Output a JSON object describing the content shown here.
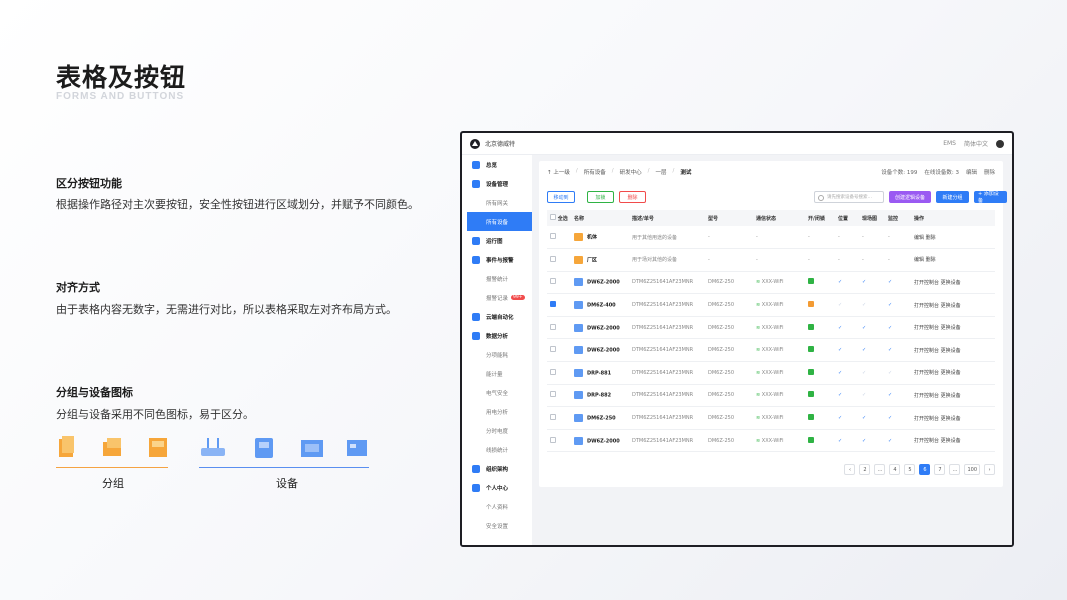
{
  "slide": {
    "title": "表格及按钮",
    "subtitle": "FORMS AND BUTTONS",
    "sections": [
      {
        "heading": "区分按钮功能",
        "text": "根据操作路径对主次要按钮，安全性按钮进行区域划分，并赋予不同颜色。"
      },
      {
        "heading": "对齐方式",
        "text": "由于表格内容无数字，无需进行对比，所以表格采取左对齐布局方式。"
      },
      {
        "heading": "分组与设备图标",
        "text": "分组与设备采用不同色图标，易于区分。"
      }
    ],
    "group_caption": "分组",
    "device_caption": "设备"
  },
  "app": {
    "company": "北京德威特",
    "top_right": [
      "EMS",
      "简体中文"
    ],
    "sidebar": [
      {
        "type": "item",
        "label": "总览"
      },
      {
        "type": "item",
        "label": "设备管理"
      },
      {
        "type": "sub",
        "label": "所有网关"
      },
      {
        "type": "sub",
        "label": "所有设备",
        "active": true
      },
      {
        "type": "item",
        "label": "运行图"
      },
      {
        "type": "item",
        "label": "事件与报警"
      },
      {
        "type": "sub",
        "label": "报警统计"
      },
      {
        "type": "sub",
        "label": "报警记录",
        "badge": "99+"
      },
      {
        "type": "item",
        "label": "云端自动化"
      },
      {
        "type": "item",
        "label": "数据分析"
      },
      {
        "type": "sub",
        "label": "分项能耗"
      },
      {
        "type": "sub",
        "label": "能计量"
      },
      {
        "type": "sub",
        "label": "电气安全"
      },
      {
        "type": "sub",
        "label": "用电分析"
      },
      {
        "type": "sub",
        "label": "分时电度"
      },
      {
        "type": "sub",
        "label": "线损统计"
      },
      {
        "type": "item",
        "label": "组织架构"
      },
      {
        "type": "item",
        "label": "个人中心"
      },
      {
        "type": "sub",
        "label": "个人资料"
      },
      {
        "type": "sub",
        "label": "安全设置"
      }
    ],
    "breadcrumbs": [
      "↑ 上一级",
      "所有设备",
      "研发中心",
      "一层",
      "测试"
    ],
    "meta": [
      "设备个数: 199",
      "在线设备数: 3",
      "编辑",
      "删除"
    ],
    "toolbar": {
      "move": "移动到",
      "add": "加锁",
      "delete": "删除",
      "search_placeholder": "请先搜索设备号搜索…",
      "create_logic": "创建逻辑设备",
      "new_group": "新建分组",
      "add_device": "+ 添加设备"
    },
    "columns": [
      "全选",
      "名称",
      "描述/单号",
      "型号",
      "通信状态",
      "开/闭锁",
      "位置",
      "现场图",
      "监控",
      "操作"
    ],
    "rows": [
      {
        "kind": "group",
        "checked": false,
        "name": "机体",
        "desc": "用于其他用途的设备",
        "model": "-",
        "status": "-",
        "lock": "-",
        "pos": "-",
        "scene": "-",
        "monitor": "-",
        "act1": "编辑",
        "act2": "删除"
      },
      {
        "kind": "group",
        "checked": false,
        "name": "厂区",
        "desc": "用于场对其他的设备",
        "model": "-",
        "status": "-",
        "lock": "-",
        "pos": "-",
        "scene": "-",
        "monitor": "-",
        "act1": "编辑",
        "act2": "删除"
      },
      {
        "kind": "device",
        "checked": false,
        "name": "DW6Z-2000",
        "desc": "DTM6Z251641AF23MNR",
        "model": "DM6Z-250",
        "status": "XXX-WiFi",
        "lock": "green",
        "pos": true,
        "scene": true,
        "monitor": true,
        "act1": "打开控制台",
        "act2": "更换设备"
      },
      {
        "kind": "device",
        "checked": true,
        "name": "DM6Z-400",
        "desc": "DTM6Z251641AF23MNR",
        "model": "DM6Z-250",
        "status": "XXX-WiFi",
        "lock": "orange",
        "pos": false,
        "scene": false,
        "monitor": true,
        "act1": "打开控制台",
        "act2": "更换设备"
      },
      {
        "kind": "device",
        "checked": false,
        "name": "DW6Z-2000",
        "desc": "DTM6Z251641AF23MNR",
        "model": "DM6Z-250",
        "status": "XXX-WiFi",
        "lock": "green",
        "pos": true,
        "scene": true,
        "monitor": true,
        "act1": "打开控制台",
        "act2": "更换设备"
      },
      {
        "kind": "device",
        "checked": false,
        "name": "DW6Z-2000",
        "desc": "DTM6Z251641AF23MNR",
        "model": "DM6Z-250",
        "status": "XXX-WiFi",
        "lock": "green",
        "pos": true,
        "scene": true,
        "monitor": true,
        "act1": "打开控制台",
        "act2": "更换设备"
      },
      {
        "kind": "device",
        "checked": false,
        "name": "DRP-881",
        "desc": "DTM6Z251641AF23MNR",
        "model": "DM6Z-250",
        "status": "XXX-WiFi",
        "lock": "green",
        "pos": true,
        "scene": false,
        "monitor": false,
        "act1": "打开控制台",
        "act2": "更换设备"
      },
      {
        "kind": "device",
        "checked": false,
        "name": "DRP-882",
        "desc": "DTM6Z251641AF23MNR",
        "model": "DM6Z-250",
        "status": "XXX-WiFi",
        "lock": "green",
        "pos": true,
        "scene": false,
        "monitor": true,
        "act1": "打开控制台",
        "act2": "更换设备"
      },
      {
        "kind": "device",
        "checked": false,
        "name": "DM6Z-250",
        "desc": "DTM6Z251641AF23MNR",
        "model": "DM6Z-250",
        "status": "XXX-WiFi",
        "lock": "green",
        "pos": true,
        "scene": true,
        "monitor": true,
        "act1": "打开控制台",
        "act2": "更换设备"
      },
      {
        "kind": "device",
        "checked": false,
        "name": "DW6Z-2000",
        "desc": "DTM6Z251641AF23MNR",
        "model": "DM6Z-250",
        "status": "XXX-WiFi",
        "lock": "green",
        "pos": true,
        "scene": true,
        "monitor": true,
        "act1": "打开控制台",
        "act2": "更换设备"
      }
    ],
    "pager": [
      "‹",
      "2",
      "…",
      "4",
      "5",
      "6",
      "7",
      "…",
      "100",
      "›"
    ],
    "pager_active": "6",
    "colors": {
      "primary": "#2f7cf6",
      "success": "#2fb344",
      "danger": "#f14b4b",
      "purple": "#9a5af2",
      "group_orange": "#f6a63a"
    }
  }
}
